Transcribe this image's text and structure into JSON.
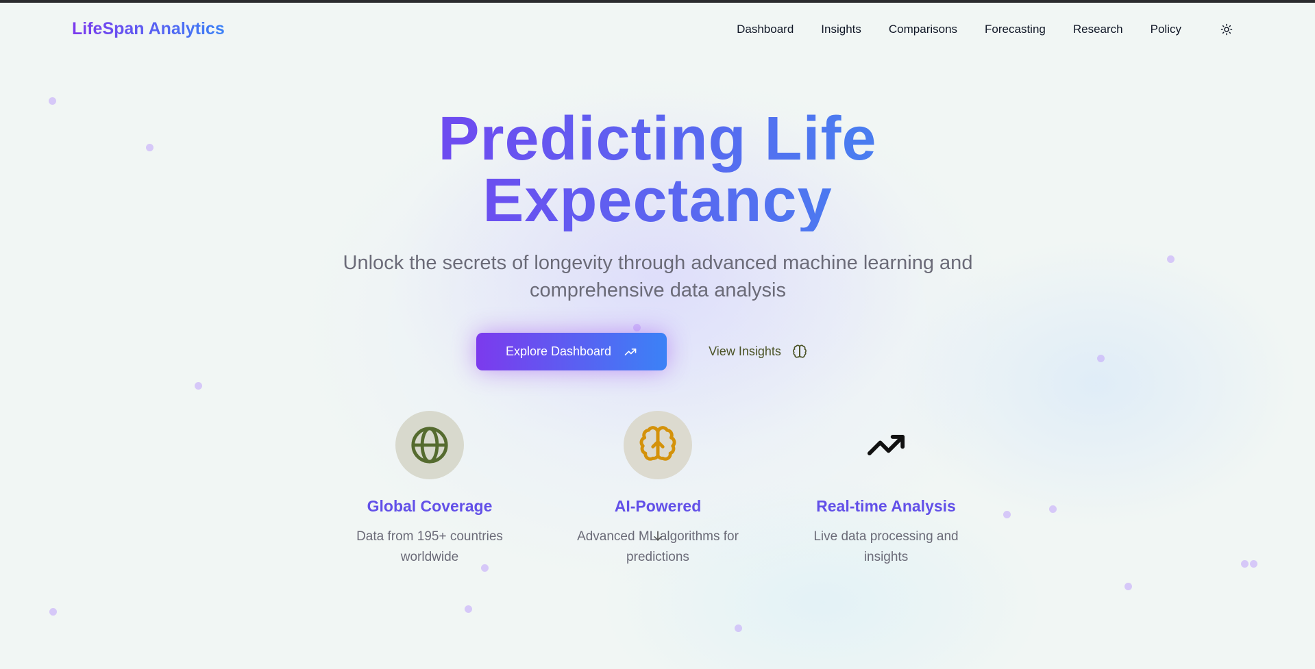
{
  "header": {
    "logo": "LifeSpan Analytics",
    "nav": [
      "Dashboard",
      "Insights",
      "Comparisons",
      "Forecasting",
      "Research",
      "Policy"
    ],
    "theme_icon": "sun-icon"
  },
  "hero": {
    "title_line1": "Predicting Life",
    "title_line2": "Expectancy",
    "subtitle": "Unlock the secrets of longevity through advanced machine learning and comprehensive data analysis",
    "primary_button": "Explore Dashboard",
    "primary_icon": "trending-up-icon",
    "secondary_button": "View Insights",
    "secondary_icon": "brain-icon"
  },
  "features": [
    {
      "icon": "globe-icon",
      "title": "Global Coverage",
      "desc": "Data from 195+ countries worldwide"
    },
    {
      "icon": "brain-icon",
      "title": "AI-Powered",
      "desc": "Advanced ML algorithms for predictions"
    },
    {
      "icon": "trending-up-icon",
      "title": "Real-time Analysis",
      "desc": "Live data processing and insights"
    }
  ],
  "colors": {
    "brand_start": "#7c3aed",
    "brand_end": "#3b82f6",
    "feature_title": "#6250e8",
    "globe": "#556b2f",
    "brain": "#d4920a"
  }
}
